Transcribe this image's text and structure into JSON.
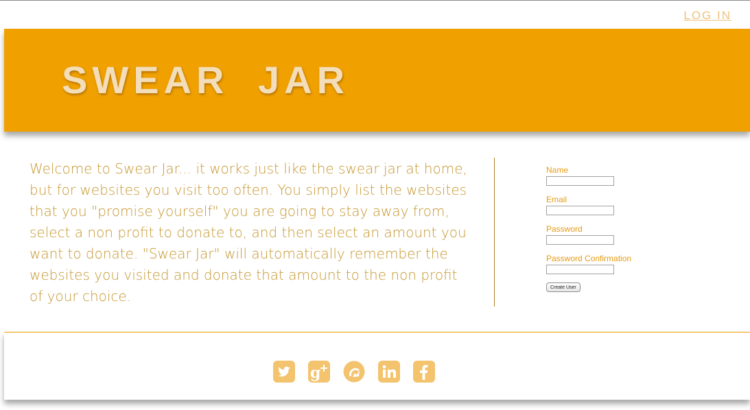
{
  "header": {
    "login_label": "LOG IN"
  },
  "banner": {
    "title": "SWEAR JAR",
    "background_color": "#f0a100"
  },
  "intro": {
    "text": "Welcome to Swear Jar... it works just like the swear jar at home, but for websites you visit too often. You simply list the websites that you \"promise yourself\" you are going to stay away from, select a non profit to donate to, and then select an amount you want to donate. \"Swear Jar\" will automatically remember the websites you visited and donate that amount to the non profit of your choice."
  },
  "signup_form": {
    "fields": [
      {
        "label": "Name",
        "value": ""
      },
      {
        "label": "Email",
        "value": ""
      },
      {
        "label": "Password",
        "value": ""
      },
      {
        "label": "Password Confirmation",
        "value": ""
      }
    ],
    "submit_label": "Create User"
  },
  "footer": {
    "social_icons": [
      "twitter-icon",
      "google-plus-icon",
      "hootsuite-icon",
      "linkedin-icon",
      "facebook-icon"
    ],
    "icon_color": "#f3c36e"
  }
}
